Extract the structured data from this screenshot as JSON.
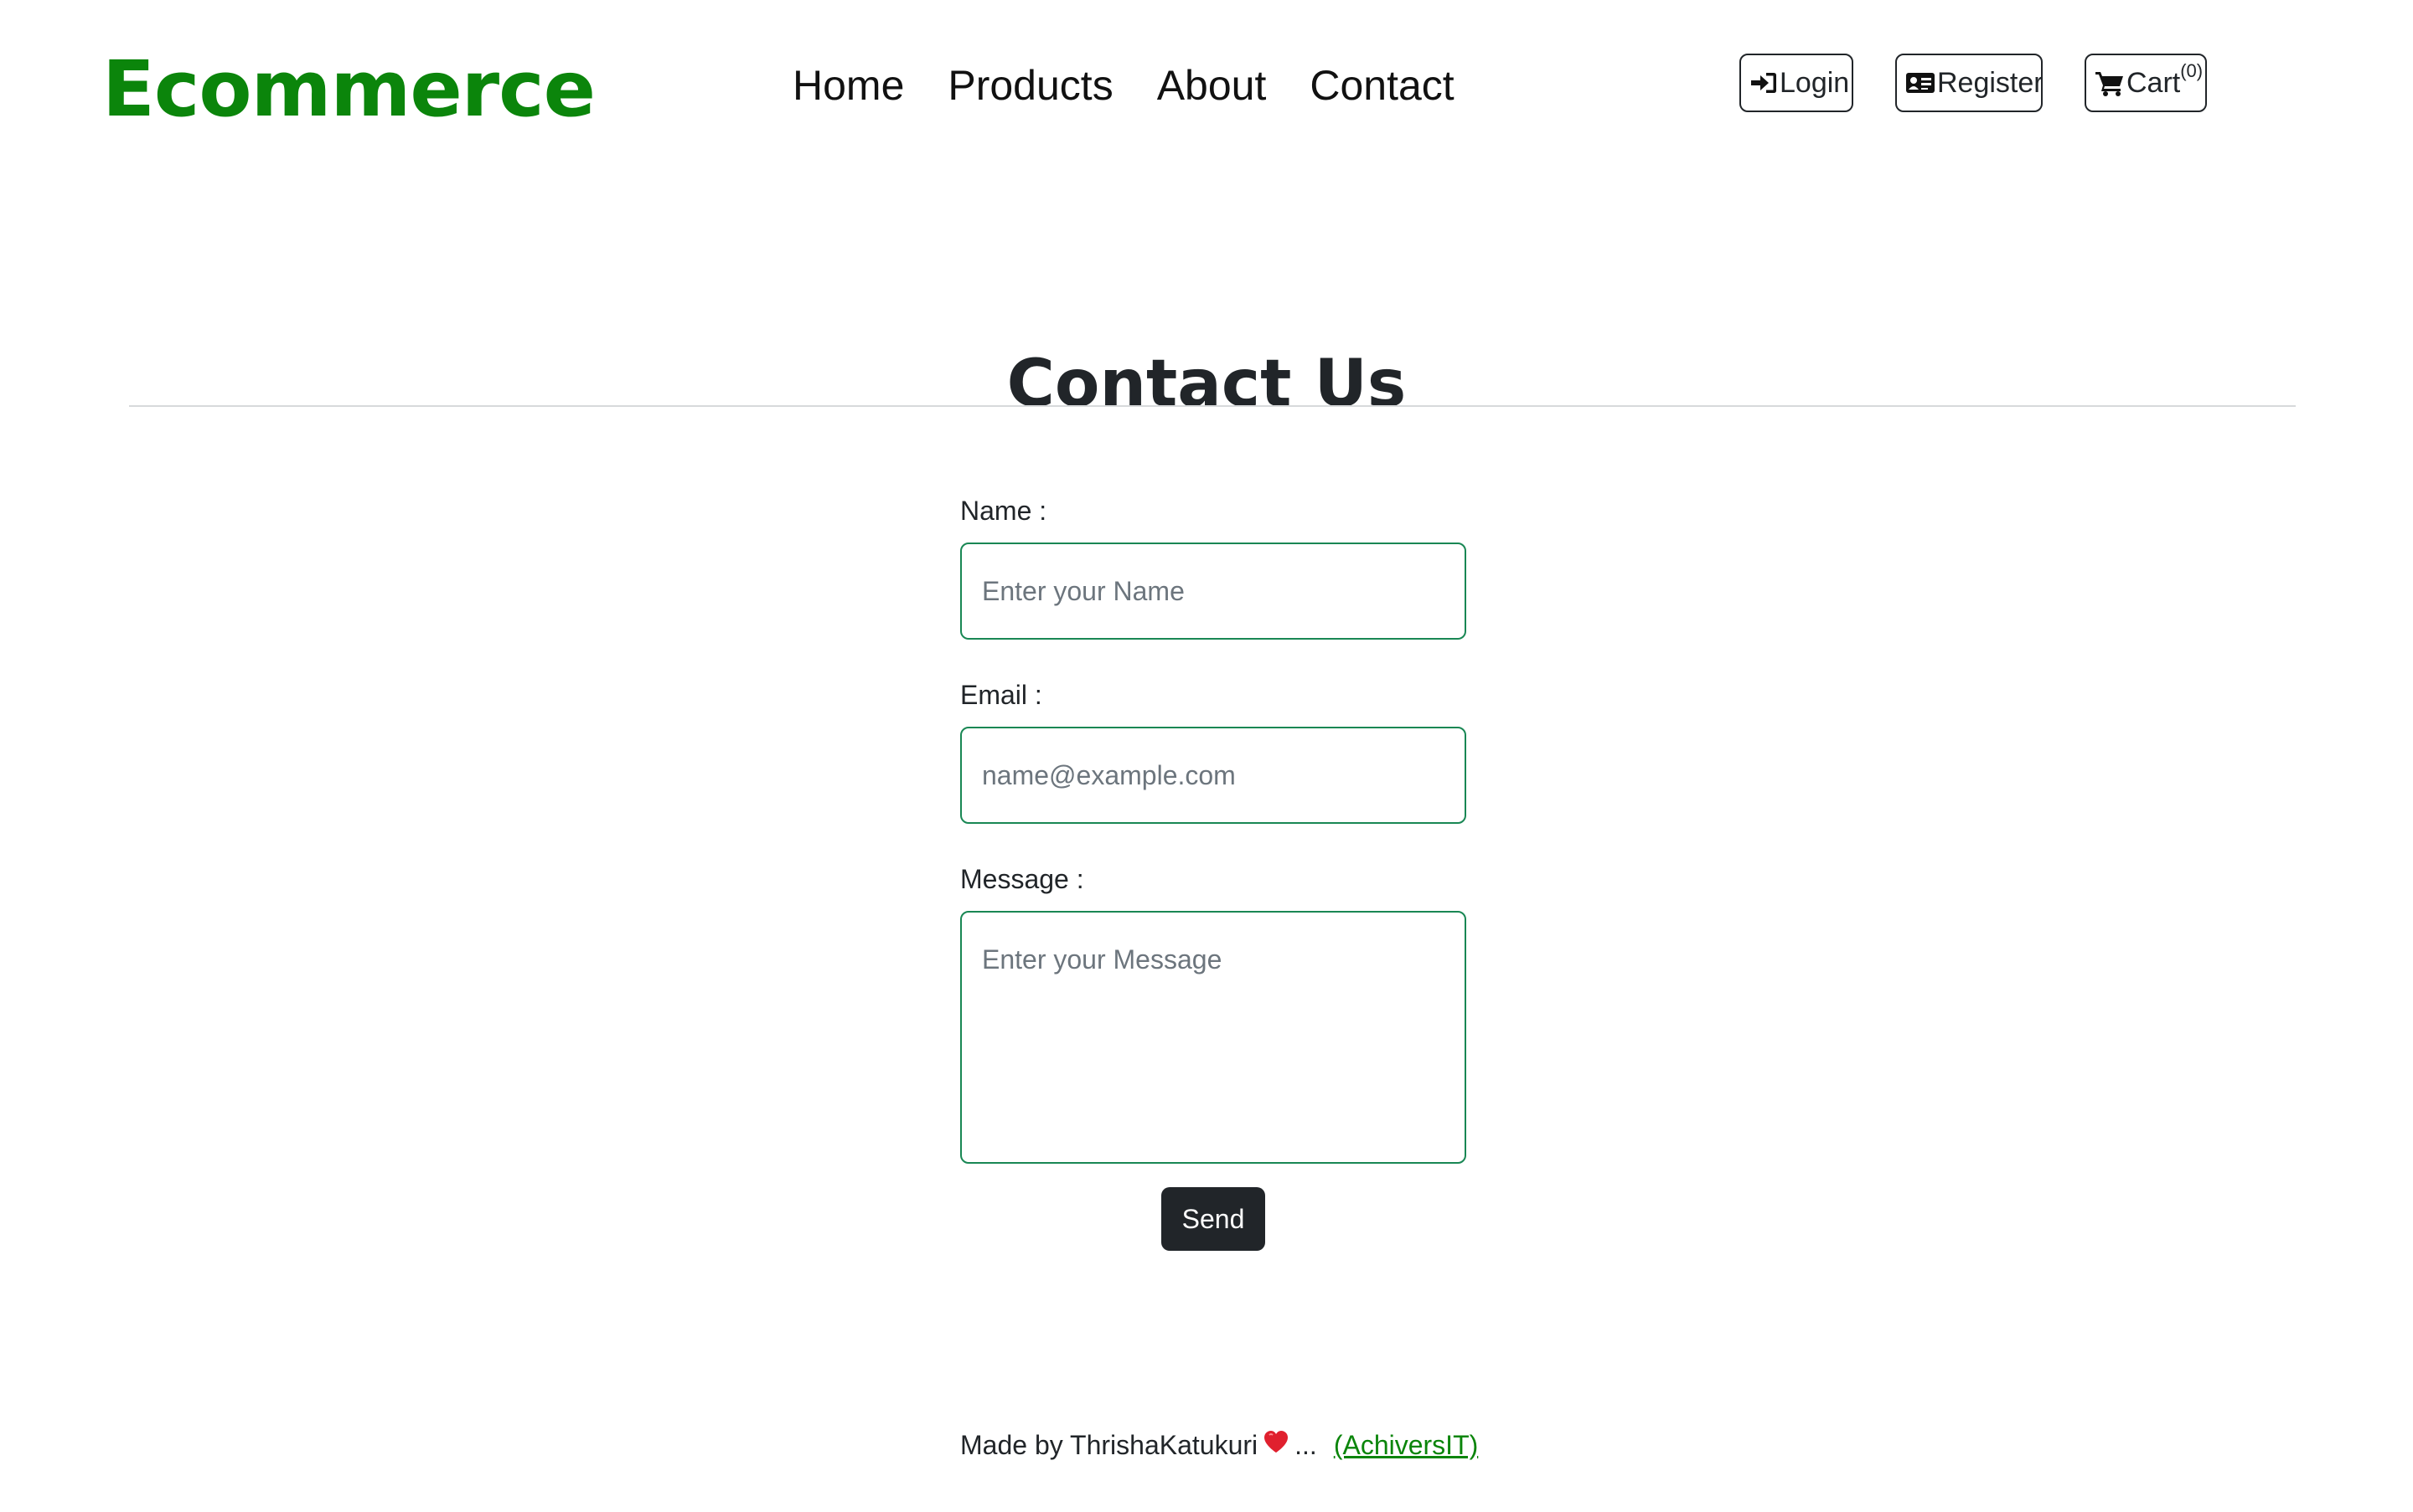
{
  "brand": "Ecommerce",
  "nav": {
    "links": [
      "Home",
      "Products",
      "About",
      "Contact"
    ]
  },
  "actions": {
    "login": "Login",
    "register": "Register",
    "cart": "Cart",
    "cart_count": "(0)"
  },
  "page": {
    "title": "Contact Us"
  },
  "form": {
    "name_label": "Name :",
    "name_placeholder": "Enter your Name",
    "email_label": "Email :",
    "email_placeholder": "name@example.com",
    "message_label": "Message :",
    "message_placeholder": "Enter your Message",
    "send": "Send"
  },
  "footer": {
    "made_by": "Made by ThrishaKatukuri",
    "ellipsis": "...",
    "link": "(AchiversIT)"
  },
  "colors": {
    "brand": "#0b850b",
    "input_border": "#198754",
    "button_dark": "#212529",
    "heart": "#e0202e"
  }
}
